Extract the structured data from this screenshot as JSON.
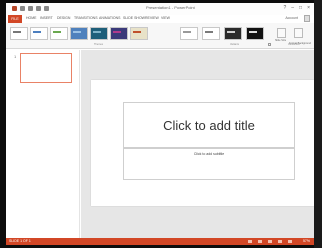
{
  "titlebar": {
    "doc_title": "Presentation1 - PowerPoint",
    "controls": [
      "?",
      "–",
      "□",
      "×"
    ]
  },
  "menu": {
    "tabs": [
      "FILE",
      "HOME",
      "INSERT",
      "DESIGN",
      "TRANSITIONS",
      "ANIMATIONS",
      "SLIDE SHOW",
      "REVIEW",
      "VIEW"
    ],
    "user": "Account"
  },
  "ribbon": {
    "themes": [
      {
        "bg": "#ffffff",
        "accent": "#777777"
      },
      {
        "bg": "#ffffff",
        "accent": "#4d7fbf"
      },
      {
        "bg": "#ffffff",
        "accent": "#6aa84f"
      },
      {
        "bg": "#4f81bd",
        "accent": "#9bc2e6"
      },
      {
        "bg": "#1f5f7a",
        "accent": "#7fb3c8"
      },
      {
        "bg": "#3b3a7a",
        "accent": "#b03a8c"
      },
      {
        "bg": "#e8e2c8",
        "accent": "#c0502c"
      },
      {
        "bg": "#ffffff",
        "accent": "#999999"
      },
      {
        "bg": "#ffffff",
        "accent": "#7a7a7a"
      },
      {
        "bg": "#2b2b2b",
        "accent": "#cfcfcf"
      },
      {
        "bg": "#111111",
        "accent": "#dddddd"
      }
    ],
    "groups": [
      "Themes",
      "Variants",
      "Customize"
    ],
    "buttons": [
      "Slide Size",
      "Format Background"
    ]
  },
  "slides": {
    "numbers": [
      "1"
    ]
  },
  "slide": {
    "title_placeholder": "Click to add title",
    "subtitle_placeholder": "Click to add subtitle"
  },
  "statusbar": {
    "left": "SLIDE 1 OF 1",
    "zoom": "57%"
  },
  "colors": {
    "accent": "#d24726",
    "thumb_selected": "#e98266"
  }
}
